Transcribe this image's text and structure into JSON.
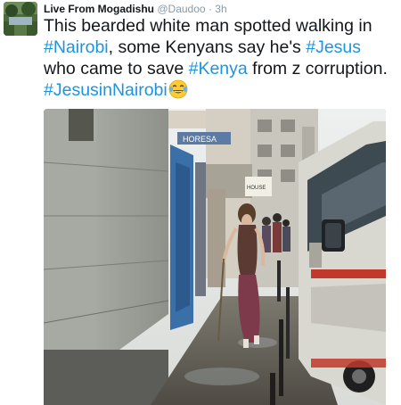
{
  "tweet": {
    "display_name": "Live From Mogadishu",
    "handle": "@Daudoo",
    "separator": "·",
    "timestamp": "3h",
    "segments": [
      {
        "text": "This bearded white man spotted walking in ",
        "type": "text"
      },
      {
        "text": "#Nairobi",
        "type": "hashtag"
      },
      {
        "text": ", some Kenyans say he's ",
        "type": "text"
      },
      {
        "text": "#Jesus",
        "type": "hashtag"
      },
      {
        "text": " who came to save ",
        "type": "text"
      },
      {
        "text": "#Kenya",
        "type": "hashtag"
      },
      {
        "text": " from z corruption. ",
        "type": "text"
      },
      {
        "text": "#JesusinNairobi",
        "type": "hashtag"
      }
    ],
    "emoji": "face-with-tears-of-joy",
    "hashtag_color": "#1b95e0",
    "text_color": "#14171a",
    "meta_color": "#8899a6"
  },
  "media": {
    "signs": [
      "HORESA",
      "HOUSE"
    ]
  }
}
